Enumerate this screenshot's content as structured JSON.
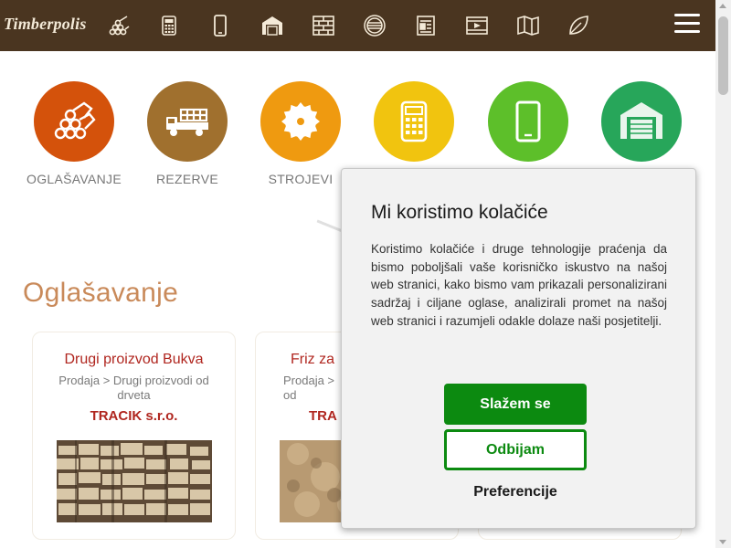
{
  "header": {
    "logo": "Timberpolis",
    "nav_icons": [
      "logs-icon",
      "calculator-icon",
      "phone-icon",
      "warehouse-icon",
      "bricks-icon",
      "round-log-icon",
      "document-icon",
      "video-icon",
      "map-icon",
      "leaf-icon"
    ]
  },
  "categories": [
    {
      "label": "OGLAŠAVANJE",
      "color": "#d4520b",
      "icon": "logs-icon"
    },
    {
      "label": "REZERVE",
      "color": "#a0702e",
      "icon": "truck-icon"
    },
    {
      "label": "STROJEVI",
      "color": "#ef9a10",
      "icon": "saw-blade-icon"
    },
    {
      "label": "",
      "color": "#f1c40f",
      "icon": "calculator-icon"
    },
    {
      "label": "",
      "color": "#5dbf2a",
      "icon": "phone-icon"
    },
    {
      "label": "",
      "color": "#27a65a",
      "icon": "warehouse-icon"
    }
  ],
  "section": {
    "title": "Oglašavanje"
  },
  "cards": [
    {
      "title": "Drugi proizvod Bukva",
      "category": "Prodaja > Drugi proizvodi od drveta",
      "company": "TRACIK s.r.o."
    },
    {
      "title": "Friz za",
      "category": "Prodaja >\nod",
      "company": "TRA"
    }
  ],
  "cookie": {
    "title": "Mi koristimo kolačiće",
    "text": "Koristimo kolačiće i druge tehnologije praćenja da bismo poboljšali vaše korisničko iskustvo na našoj web stranici, kako bismo vam prikazali personalizirani sadržaj i ciljane oglase, analizirali promet na našoj web stranici i razumjeli odakle dolaze naši posjetitelji.",
    "accept": "Slažem se",
    "reject": "Odbijam",
    "preferences": "Preferencije"
  }
}
